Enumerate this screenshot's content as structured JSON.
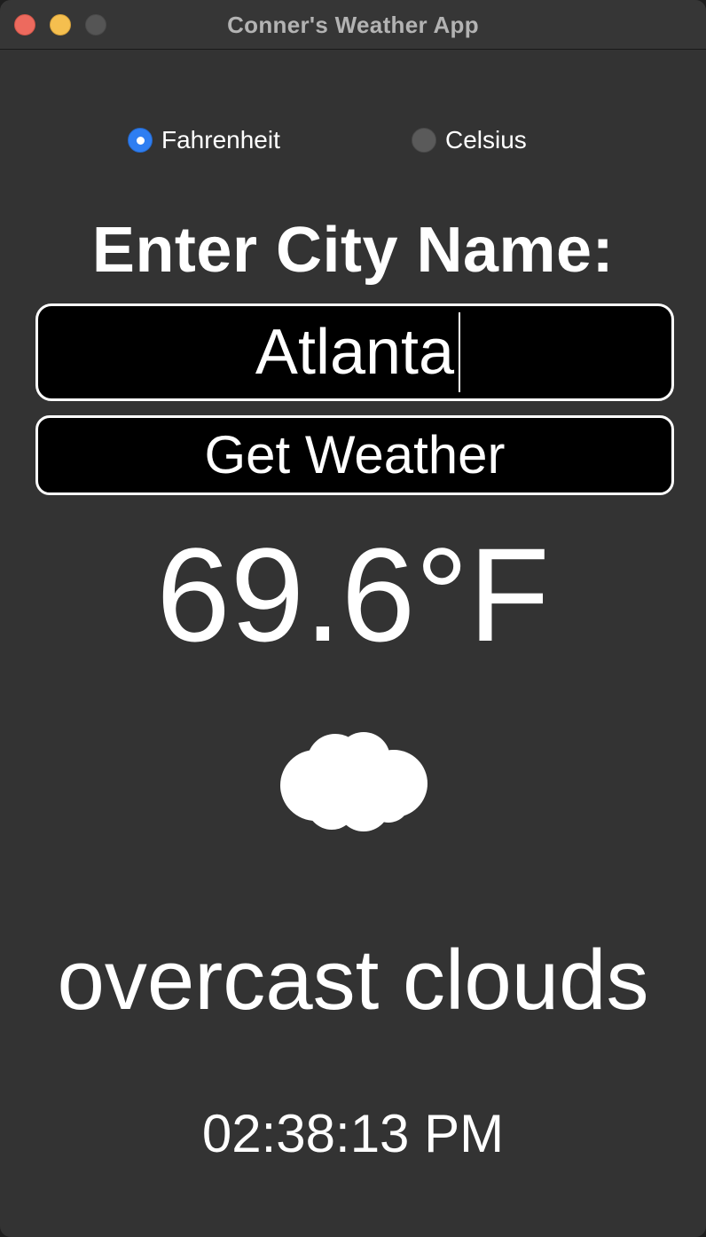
{
  "window": {
    "title": "Conner's Weather App"
  },
  "units": {
    "options": [
      {
        "label": "Fahrenheit",
        "selected": true
      },
      {
        "label": "Celsius",
        "selected": false
      }
    ]
  },
  "form": {
    "heading": "Enter City Name:",
    "city_value": "Atlanta",
    "button_label": "Get Weather"
  },
  "result": {
    "temperature": "69.6°F",
    "icon": "cloud-icon",
    "description": "overcast clouds",
    "time": "02:38:13 PM"
  },
  "colors": {
    "background": "#333333",
    "accent": "#2e7ef2",
    "text": "#ffffff"
  }
}
